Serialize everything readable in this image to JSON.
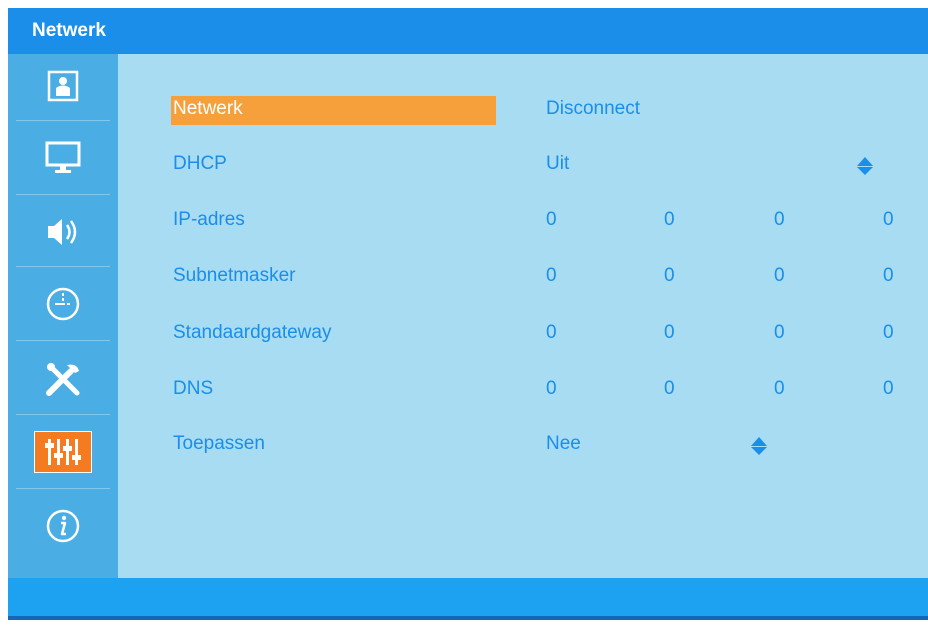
{
  "header": {
    "title": "Netwerk"
  },
  "sidebar": {
    "items": [
      {
        "icon": "person-icon"
      },
      {
        "icon": "monitor-icon"
      },
      {
        "icon": "speaker-icon"
      },
      {
        "icon": "clock-icon"
      },
      {
        "icon": "tools-icon"
      },
      {
        "icon": "sliders-icon",
        "active": true
      },
      {
        "icon": "info-icon"
      }
    ]
  },
  "menu": {
    "netwerk": {
      "label": "Netwerk",
      "value": "Disconnect"
    },
    "dhcp": {
      "label": "DHCP",
      "value": "Uit"
    },
    "ip": {
      "label": "IP-adres",
      "octets": [
        "0",
        "0",
        "0",
        "0"
      ]
    },
    "subnet": {
      "label": "Subnetmasker",
      "octets": [
        "0",
        "0",
        "0",
        "0"
      ]
    },
    "gateway": {
      "label": "Standaardgateway",
      "octets": [
        "0",
        "0",
        "0",
        "0"
      ]
    },
    "dns": {
      "label": "DNS",
      "octets": [
        "0",
        "0",
        "0",
        "0"
      ]
    },
    "apply": {
      "label": "Toepassen",
      "value": "Nee"
    }
  },
  "colors": {
    "accent": "#1a8ee8",
    "selection": "#f5a03a",
    "active_tab": "#f47b20",
    "panel": "#a8dcf2"
  }
}
